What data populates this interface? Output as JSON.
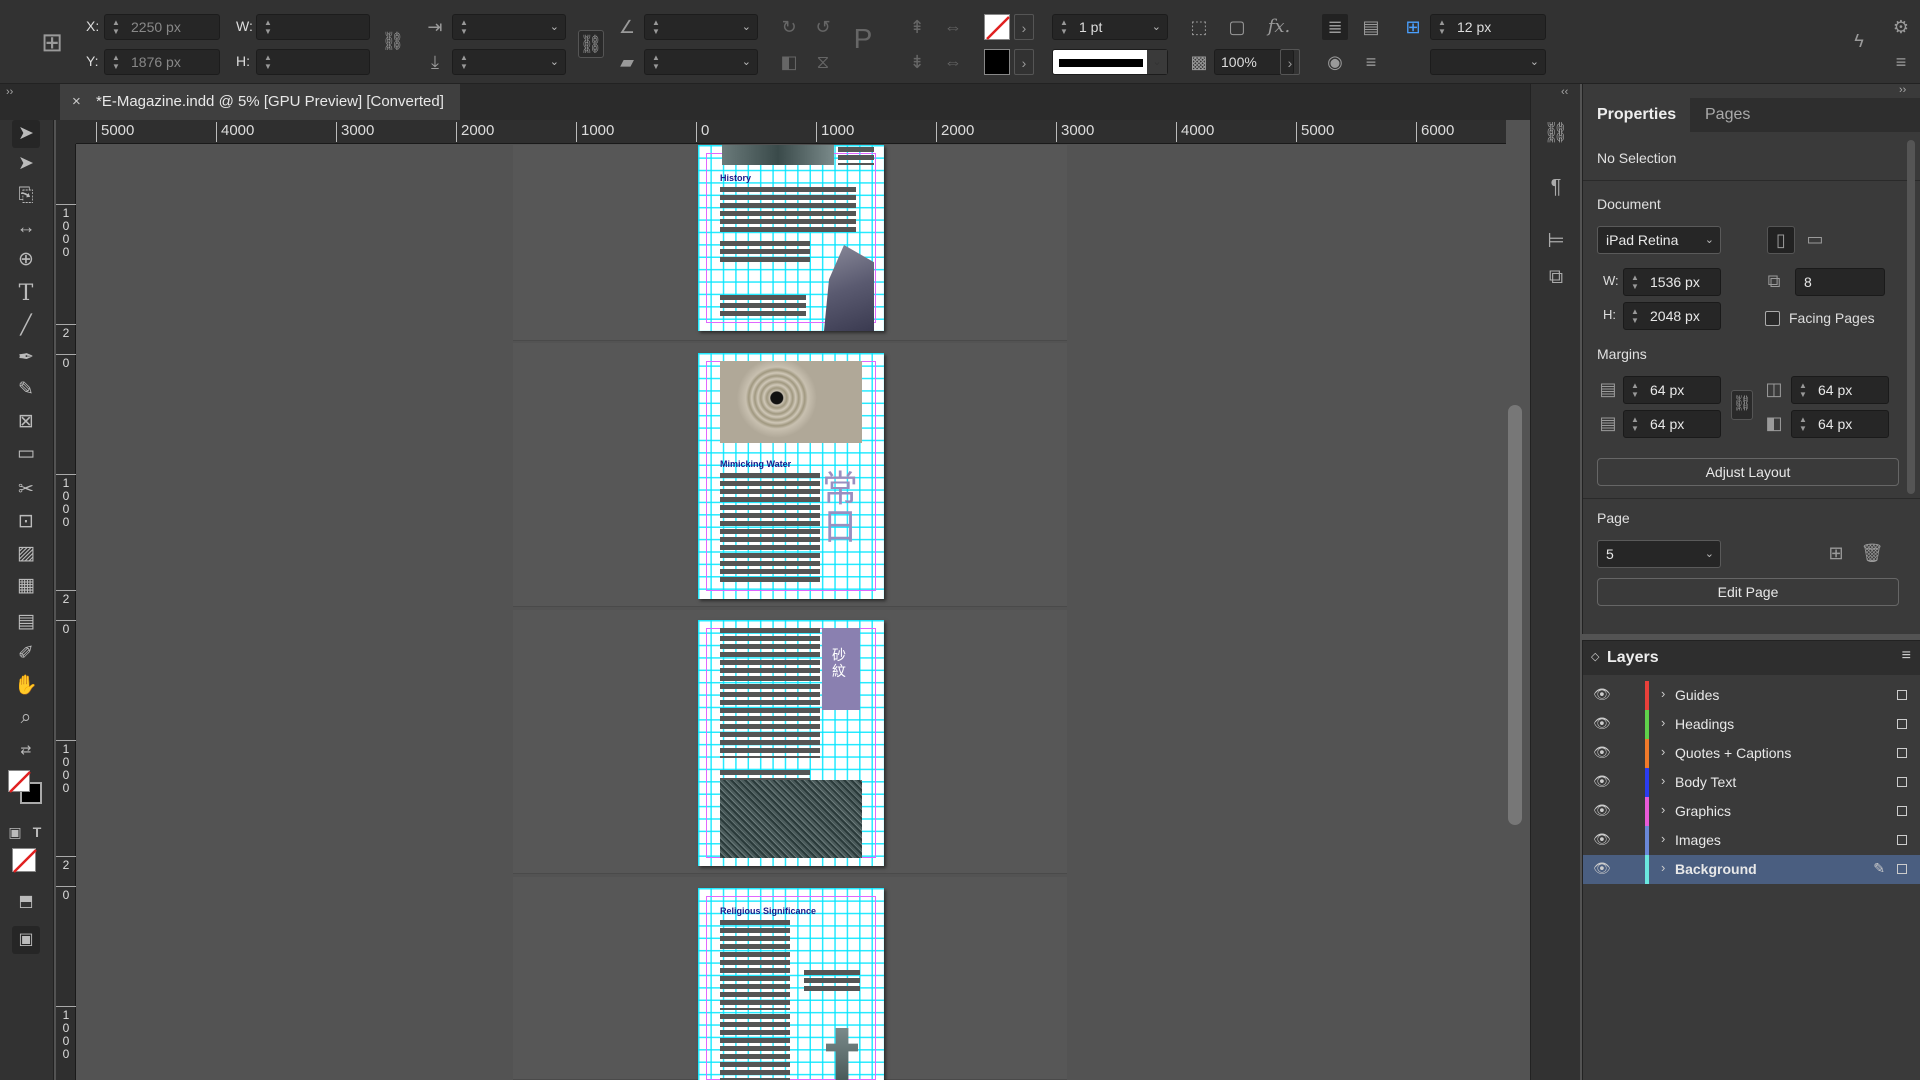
{
  "control_bar": {
    "x_label": "X:",
    "y_label": "Y:",
    "w_label": "W:",
    "h_label": "H:",
    "x_value": "2250 px",
    "y_value": "1876 px",
    "stroke_weight": "1 pt",
    "opacity": "100%",
    "gap_value": "12 px"
  },
  "document_tab": {
    "title": "*E-Magazine.indd @ 5% [GPU Preview] [Converted]",
    "close_icon": "×"
  },
  "ruler": {
    "horizontal_ticks": [
      "5000",
      "4000",
      "3000",
      "2000",
      "1000",
      "0",
      "1000",
      "2000",
      "3000",
      "4000",
      "5000",
      "6000"
    ],
    "vertical_ticks": [
      "1\n0\n0\n0",
      "2",
      "0",
      "1\n0\n0\n0",
      "2",
      "0",
      "1\n0\n0\n0",
      "2",
      "0",
      "1\n0\n0\n0"
    ]
  },
  "pages": [
    {
      "heading": "History"
    },
    {
      "heading": "Mimicking Water",
      "kanji": "常\n日"
    },
    {
      "heading": "",
      "kanji": "砂\n紋"
    },
    {
      "heading": "Religious Significance"
    }
  ],
  "properties": {
    "tabs": [
      "Properties",
      "Pages"
    ],
    "selection_status": "No Selection",
    "document_label": "Document",
    "preset": "iPad Retina",
    "width_label": "W:",
    "width": "1536 px",
    "height_label": "H:",
    "height": "2048 px",
    "pages_count": "8",
    "facing_pages_label": "Facing Pages",
    "margins_label": "Margins",
    "margin_top": "64 px",
    "margin_bottom": "64 px",
    "margin_inside": "64 px",
    "margin_outside": "64 px",
    "adjust_layout": "Adjust Layout",
    "page_label": "Page",
    "page_number": "5",
    "edit_page": "Edit Page"
  },
  "layers": {
    "title": "Layers",
    "items": [
      {
        "name": "Guides",
        "color": "#e8403a"
      },
      {
        "name": "Headings",
        "color": "#5fd24a"
      },
      {
        "name": "Quotes + Captions",
        "color": "#f07a2a"
      },
      {
        "name": "Body Text",
        "color": "#2a3cf0"
      },
      {
        "name": "Graphics",
        "color": "#e85ad8"
      },
      {
        "name": "Images",
        "color": "#6a88d8"
      },
      {
        "name": "Background",
        "color": "#6ae8e0"
      }
    ]
  }
}
